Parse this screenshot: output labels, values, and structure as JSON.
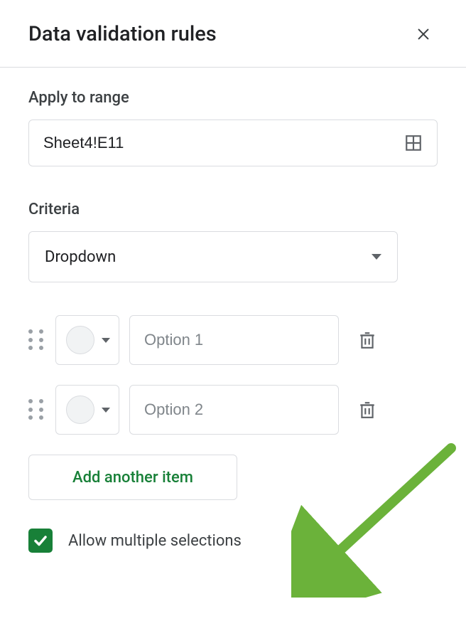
{
  "header": {
    "title": "Data validation rules"
  },
  "apply_range": {
    "label": "Apply to range",
    "value": "Sheet4!E11"
  },
  "criteria": {
    "label": "Criteria",
    "selected": "Dropdown"
  },
  "options": [
    {
      "placeholder": "Option 1",
      "value": ""
    },
    {
      "placeholder": "Option 2",
      "value": ""
    }
  ],
  "add_item_label": "Add another item",
  "allow_multiple": {
    "label": "Allow multiple selections",
    "checked": true
  }
}
